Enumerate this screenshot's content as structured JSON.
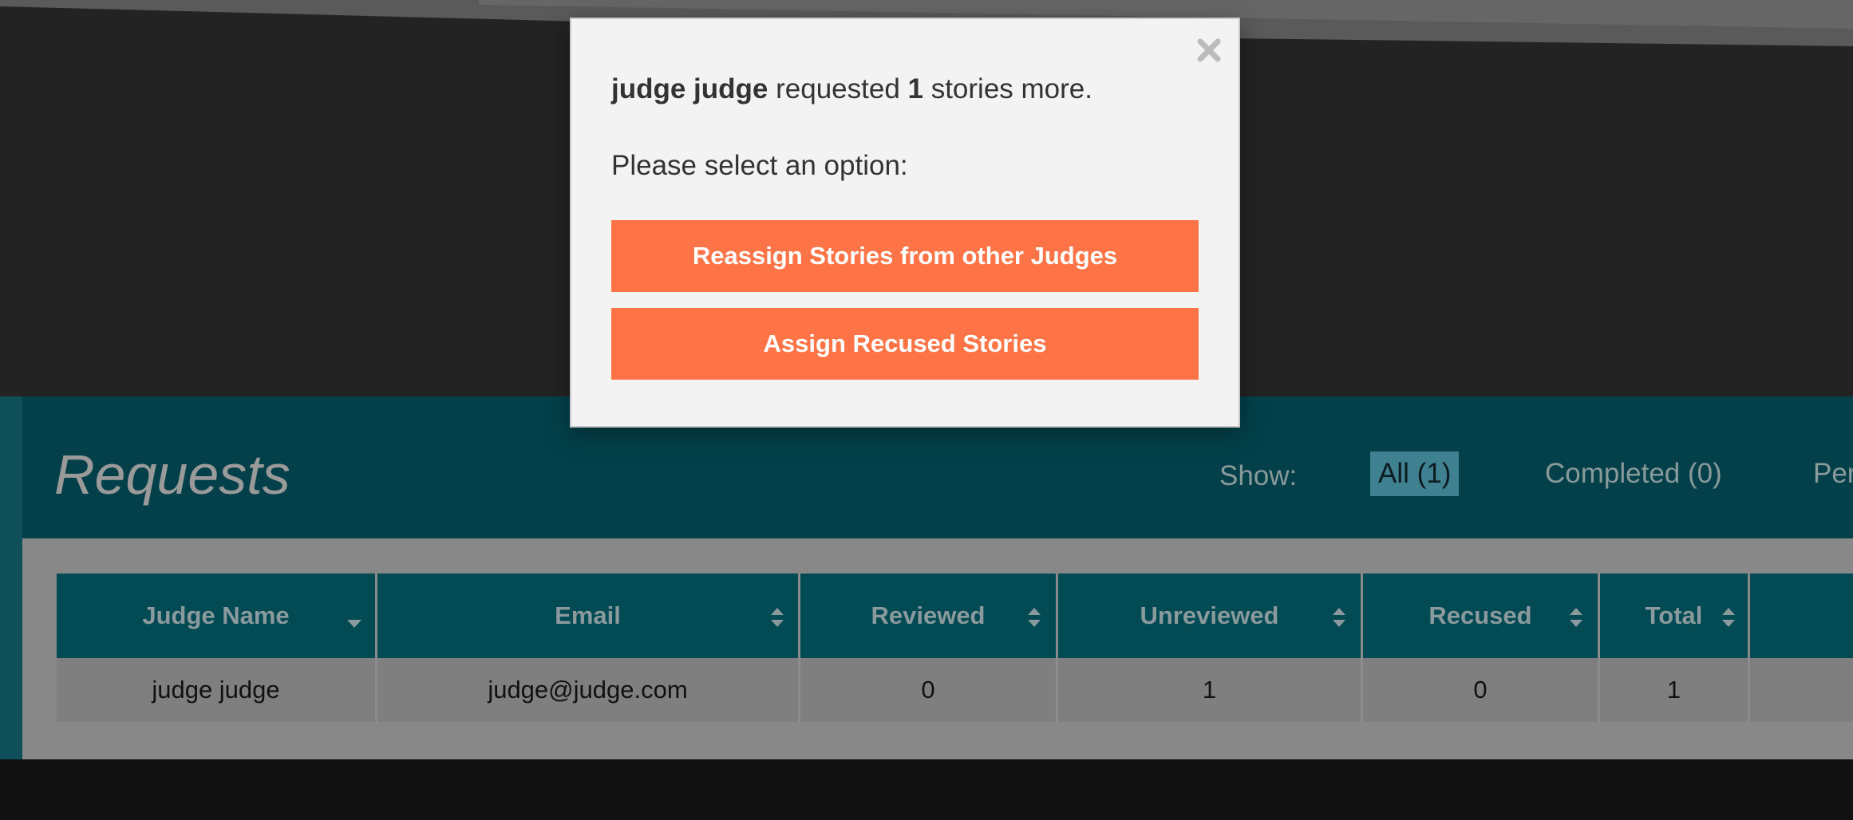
{
  "modal": {
    "judge_name": "judge judge",
    "text_requested": " requested ",
    "count": "1",
    "text_suffix": " stories more.",
    "prompt": "Please select an option:",
    "button_reassign": "Reassign Stories from other Judges",
    "button_recused": "Assign Recused Stories",
    "close_icon": "close-icon"
  },
  "requests": {
    "title": "Requests",
    "show_label": "Show:",
    "filters": [
      "All (1)",
      "Completed (0)",
      "Per"
    ],
    "active_filter": "All (1)"
  },
  "table": {
    "columns": [
      "Judge Name",
      "Email",
      "Reviewed",
      "Unreviewed",
      "Recused",
      "Total",
      ""
    ],
    "rows": [
      {
        "judge_name": "judge judge",
        "email": "judge@judge.com",
        "reviewed": "0",
        "unreviewed": "1",
        "recused": "0",
        "total": "1",
        "extra": ""
      }
    ]
  },
  "colors": {
    "accent": "#fe7446",
    "header_teal": "#034049",
    "table_header": "#024a54"
  }
}
